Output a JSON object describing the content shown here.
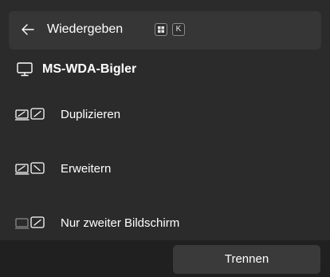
{
  "header": {
    "back_icon": "arrow-left-icon",
    "title": "Wiedergeben",
    "shortcut": {
      "modifier_icon": "windows-key-icon",
      "key": "K"
    }
  },
  "device": {
    "icon": "monitor-icon",
    "name": "MS-WDA-Bigler"
  },
  "options": [
    {
      "label": "Duplizieren",
      "icon": "duplicate-screens-icon"
    },
    {
      "label": "Erweitern",
      "icon": "extend-screens-icon"
    },
    {
      "label": "Nur zweiter Bildschirm",
      "icon": "second-screen-only-icon"
    }
  ],
  "footer": {
    "disconnect_label": "Trennen"
  },
  "colors": {
    "background": "#2b2b2b",
    "header_background": "#363636",
    "footer_background": "#202020",
    "button_background": "#3a3a3a",
    "text": "#ffffff",
    "dim_icon": "#8a8a8a"
  }
}
